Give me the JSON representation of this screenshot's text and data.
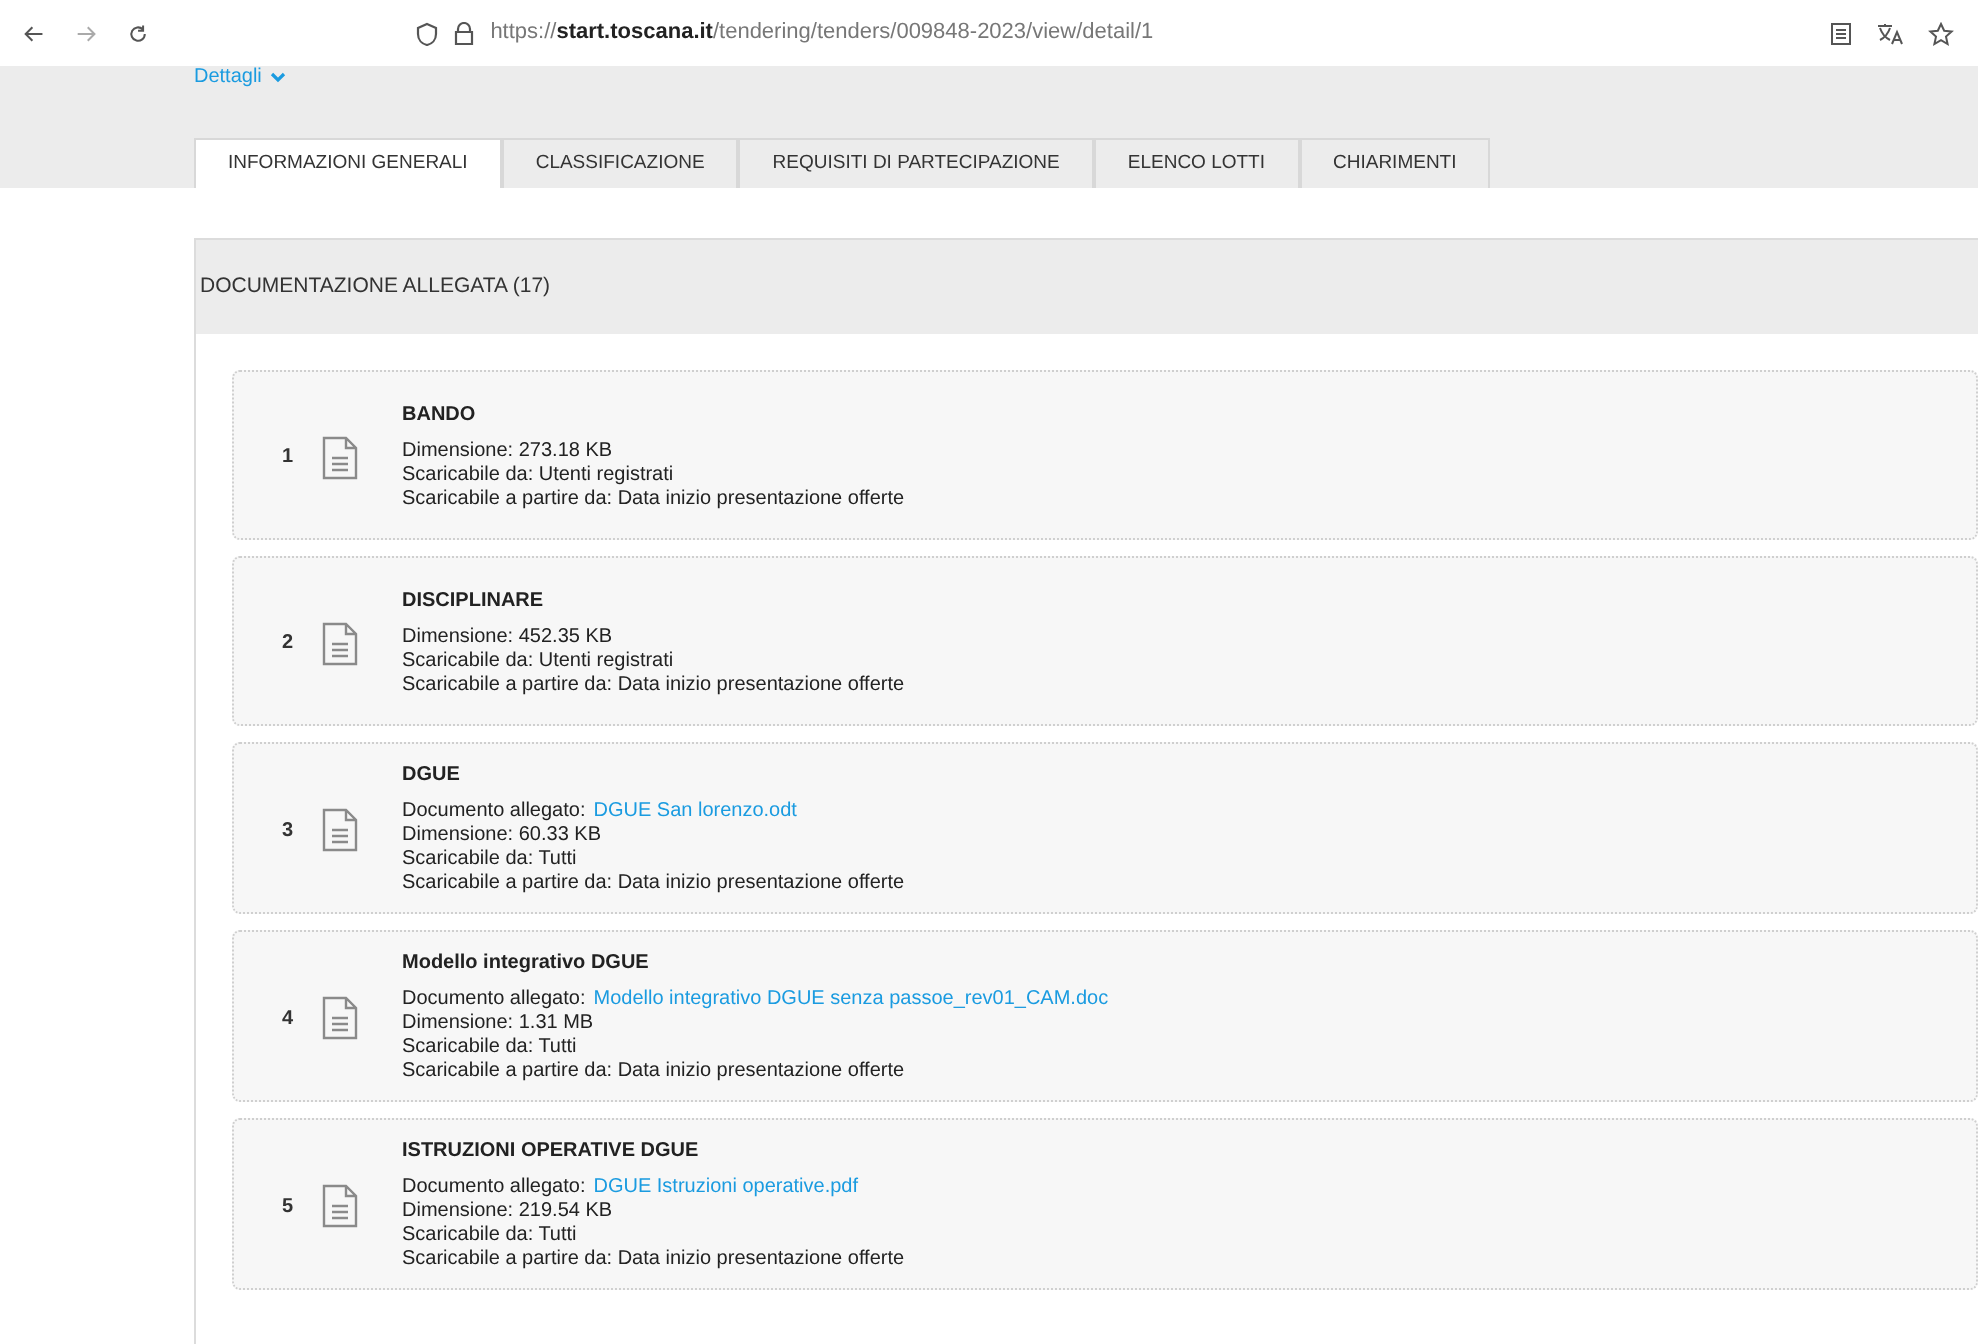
{
  "browser": {
    "url": "https://**start.toscana.it**/tendering/tenders/009848-2023/view/detail/1"
  },
  "details_toggle": {
    "label": "Dettagli"
  },
  "tabs": [
    {
      "label": "INFORMAZIONI GENERALI",
      "selected": true
    },
    {
      "label": "CLASSIFICAZIONE",
      "selected": false
    },
    {
      "label": "REQUISITI DI PARTECIPAZIONE",
      "selected": false
    },
    {
      "label": "ELENCO LOTTI",
      "selected": false
    },
    {
      "label": "CHIARIMENTI",
      "selected": false
    }
  ],
  "panel": {
    "title": "DOCUMENTAZIONE ALLEGATA (17)"
  },
  "documents": [
    {
      "number": "1",
      "title": "BANDO",
      "lines": [
        "Dimensione: 273.18 KB",
        "Scaricabile da: Utenti registrati",
        "Scaricabile a partire da: Data inizio presentazione offerte"
      ]
    },
    {
      "number": "2",
      "title": "DISCIPLINARE",
      "lines": [
        "Dimensione: 452.35 KB",
        "Scaricabile da: Utenti registrati",
        "Scaricabile a partire da: Data inizio presentazione offerte"
      ]
    },
    {
      "number": "3",
      "title": "DGUE",
      "attachment": {
        "label": "Documento allegato:",
        "link": "DGUE San lorenzo.odt"
      },
      "lines": [
        "Dimensione: 60.33 KB",
        "Scaricabile da: Tutti",
        "Scaricabile a partire da: Data inizio presentazione offerte"
      ]
    },
    {
      "number": "4",
      "title": "Modello integrativo DGUE",
      "attachment": {
        "label": "Documento allegato:",
        "link": "Modello integrativo DGUE senza passoe_rev01_CAM.doc"
      },
      "lines": [
        "Dimensione: 1.31 MB",
        "Scaricabile da: Tutti",
        "Scaricabile a partire da: Data inizio presentazione offerte"
      ]
    },
    {
      "number": "5",
      "title": "ISTRUZIONI OPERATIVE DGUE",
      "attachment": {
        "label": "Documento allegato:",
        "link": "DGUE Istruzioni operative.pdf"
      },
      "lines": [
        "Dimensione: 219.54 KB",
        "Scaricabile da: Tutti",
        "Scaricabile a partire da: Data inizio presentazione offerte"
      ]
    }
  ]
}
